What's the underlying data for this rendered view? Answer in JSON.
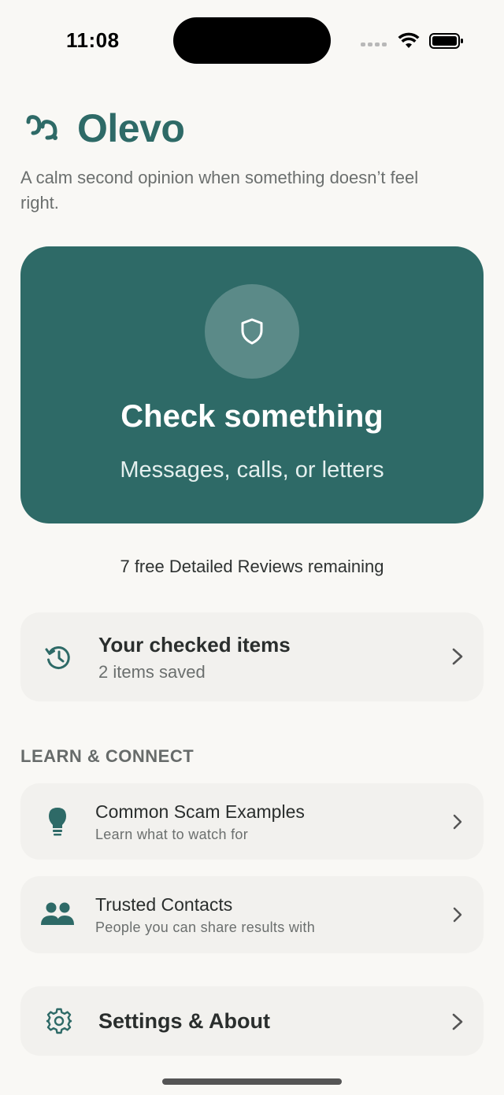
{
  "status_bar": {
    "time": "11:08"
  },
  "header": {
    "brand_name": "Olevo",
    "tagline": "A calm second opinion when something doesn’t feel right."
  },
  "hero": {
    "title": "Check something",
    "subtitle": "Messages, calls, or letters",
    "icon": "shield-icon"
  },
  "quota_text": "7 free Detailed Reviews remaining",
  "checked_items": {
    "title": "Your checked items",
    "subtitle": "2 items saved",
    "icon": "history-icon"
  },
  "learn_section": {
    "heading": "LEARN & CONNECT",
    "items": [
      {
        "title": "Common Scam Examples",
        "subtitle": "Learn what to watch for",
        "icon": "lightbulb-icon"
      },
      {
        "title": "Trusted Contacts",
        "subtitle": "People you can share results with",
        "icon": "people-icon"
      }
    ]
  },
  "settings": {
    "title": "Settings & About",
    "icon": "gear-icon"
  },
  "colors": {
    "accent": "#2e6a67",
    "background": "#f9f8f5",
    "card": "#f2f1ee",
    "text_primary": "#2a2e2d",
    "text_secondary": "#6b6f6e"
  }
}
